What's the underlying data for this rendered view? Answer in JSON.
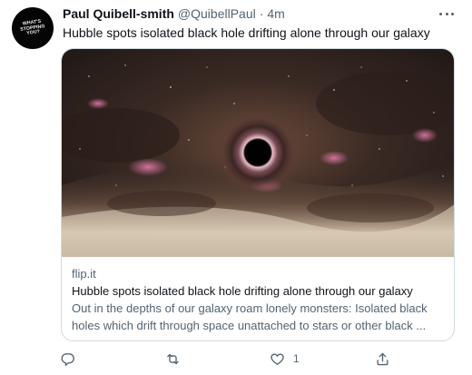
{
  "author": {
    "avatar_text": "WHAT'S\nSTOPPING\nYOU?",
    "display_name": "Paul Quibell-smith",
    "handle": "@QuibellPaul",
    "separator": "·",
    "time": "4m"
  },
  "tweet": {
    "text": "Hubble spots isolated black hole drifting alone through our galaxy"
  },
  "card": {
    "domain": "flip.it",
    "title": "Hubble spots isolated black hole drifting alone through our galaxy",
    "description": "Out in the depths of our galaxy roam lonely monsters: Isolated black holes which drift through space unattached to stars or other black ...",
    "image_icon": "black-hole-image"
  },
  "actions": {
    "reply": {
      "icon": "reply-icon",
      "count": ""
    },
    "retweet": {
      "icon": "retweet-icon",
      "count": ""
    },
    "like": {
      "icon": "heart-icon",
      "count": "1"
    },
    "share": {
      "icon": "share-icon",
      "count": ""
    }
  },
  "colors": {
    "text_primary": "#0f1419",
    "text_secondary": "#536471",
    "card_border": "#cfd9de"
  }
}
